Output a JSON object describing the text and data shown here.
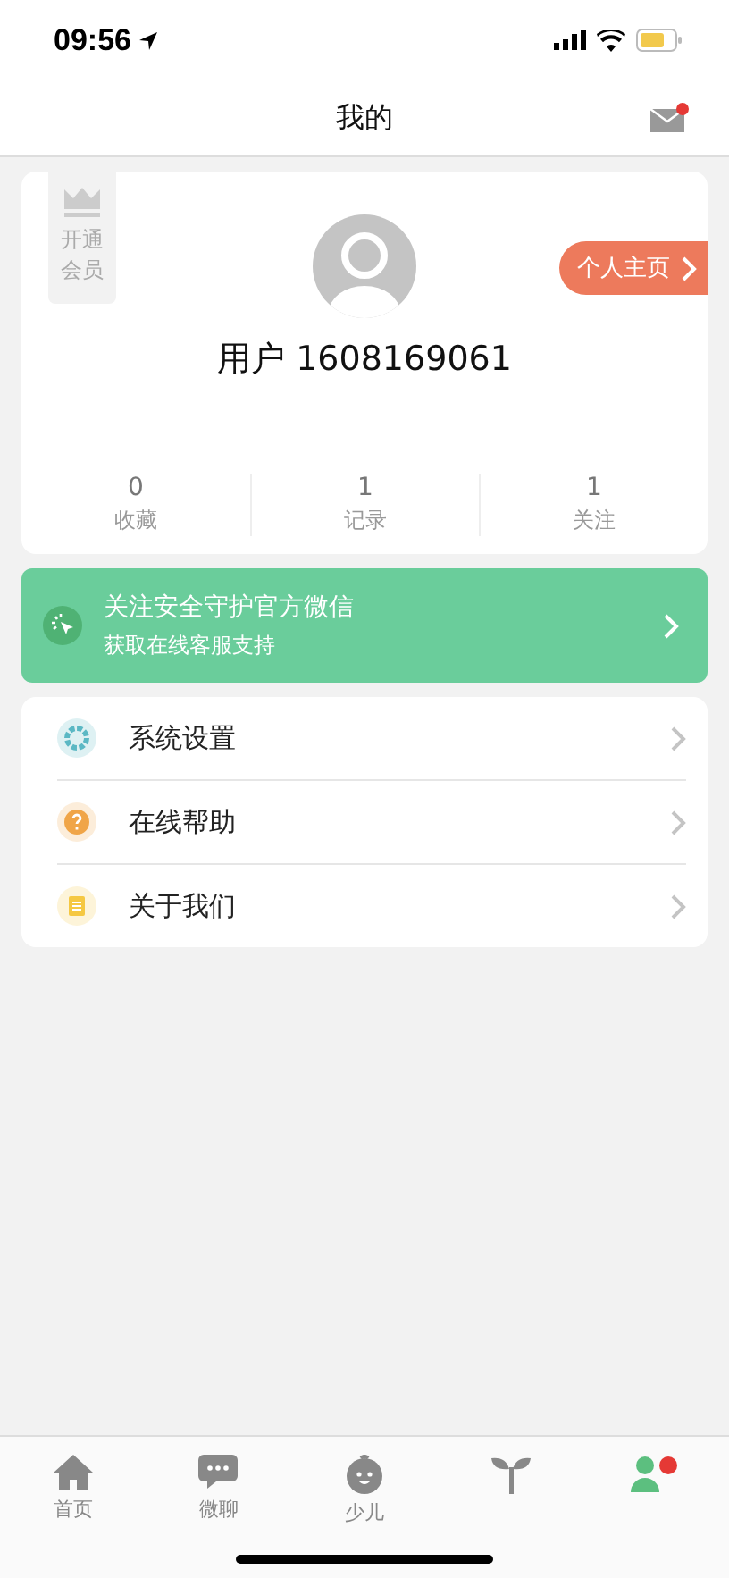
{
  "status_bar": {
    "time": "09:56"
  },
  "header": {
    "title": "我的",
    "mail_unread": true
  },
  "profile": {
    "vip_label": "开通会员",
    "homepage_button": "个人主页",
    "username": "用户 1608169061",
    "stats": [
      {
        "value": "0",
        "label": "收藏"
      },
      {
        "value": "1",
        "label": "记录"
      },
      {
        "value": "1",
        "label": "关注"
      }
    ]
  },
  "banner": {
    "title": "关注安全守护官方微信",
    "subtitle": "获取在线客服支持"
  },
  "menu": [
    {
      "label": "系统设置",
      "color": "#5bb8c4"
    },
    {
      "label": "在线帮助",
      "color": "#f0a548"
    },
    {
      "label": "关于我们",
      "color": "#f5c842"
    }
  ],
  "tabs": [
    {
      "label": "首页",
      "selected": false
    },
    {
      "label": "微聊",
      "selected": false
    },
    {
      "label": "少儿",
      "selected": false
    },
    {
      "selected": false
    },
    {
      "selected": true,
      "badge": true
    }
  ]
}
